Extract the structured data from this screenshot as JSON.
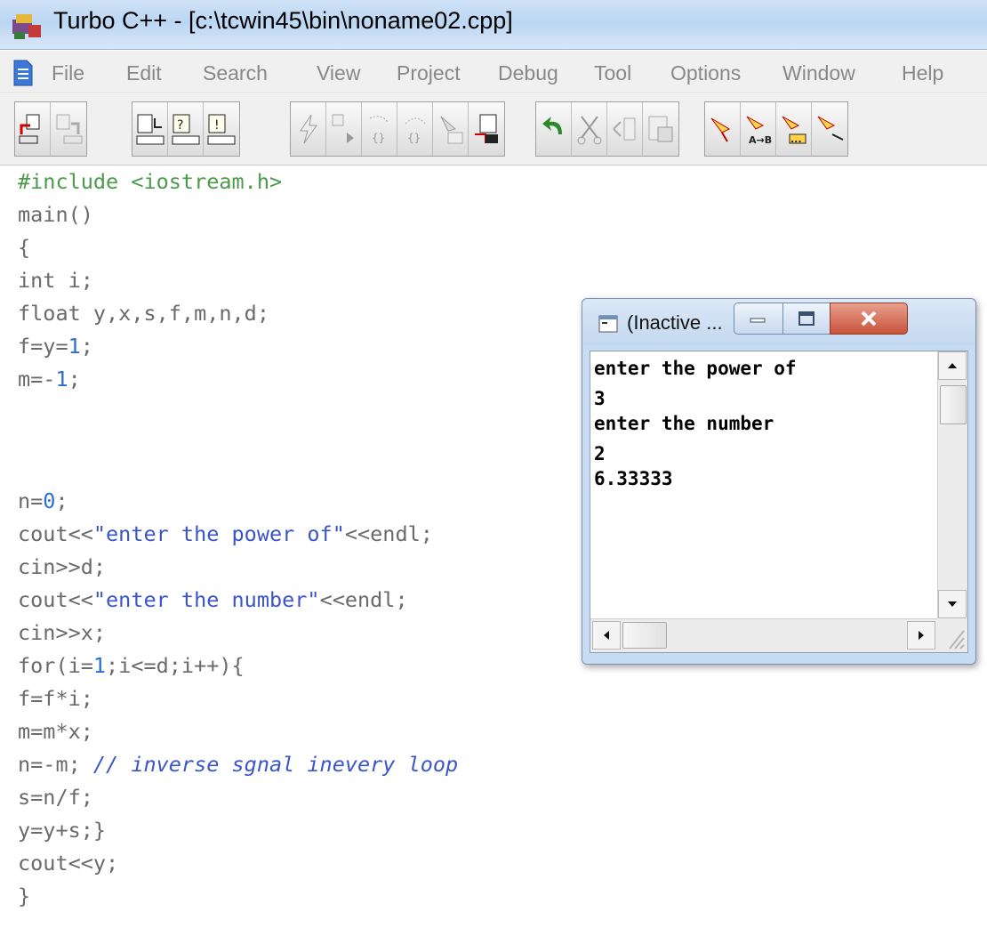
{
  "window": {
    "title": "Turbo C++ - [c:\\tcwin45\\bin\\noname02.cpp]",
    "icon": "turbo-cpp-icon"
  },
  "menu": {
    "icon": "document-icon",
    "items": [
      "File",
      "Edit",
      "Search",
      "View",
      "Project",
      "Debug",
      "Tool",
      "Options",
      "Window",
      "Help"
    ]
  },
  "toolbar": {
    "groups": [
      [
        "open-project-icon",
        "close-project-icon"
      ],
      [
        "compile-icon",
        "make-icon",
        "build-icon"
      ],
      [
        "lightning-icon",
        "step-into-icon",
        "trace-icon",
        "step-over-icon",
        "inspect-icon",
        "evaluate-icon"
      ],
      [
        "undo-icon",
        "cut-icon",
        "copy-icon",
        "paste-icon"
      ],
      [
        "search-icon",
        "replace-icon",
        "search-again-icon",
        "browse-icon"
      ]
    ]
  },
  "editor": {
    "lines": [
      "#include <iostream.h>",
      "main()",
      "{",
      "int i;",
      "float y,x,s,f,m,n,d;",
      "f=y=1;",
      "m=-1;",
      "",
      "",
      "n=0;",
      "cout<<\"enter the power of\"<<endl;",
      "cin>>d;",
      "cout<<\"enter the number\"<<endl;",
      "cin>>x;",
      "for(i=1;i<=d;i++){",
      "f=f*i;",
      "m=m*x;",
      "n=-m; // inverse sgnal inevery loop",
      "s=n/f;",
      "y=y+s;}",
      "cout<<y;",
      "}"
    ]
  },
  "console": {
    "title": "(Inactive ...",
    "output": [
      "enter the power of",
      "3",
      "enter the number",
      "2",
      "6.33333"
    ],
    "buttons": {
      "minimize": "minimize-icon",
      "maximize": "maximize-icon",
      "close": "close-icon"
    }
  },
  "colors": {
    "number": "#2b6fd6",
    "string": "#3a55c8",
    "comment": "#3a55c8",
    "preprocessor": "#4a9a4a",
    "code": "#6a6a6a"
  }
}
